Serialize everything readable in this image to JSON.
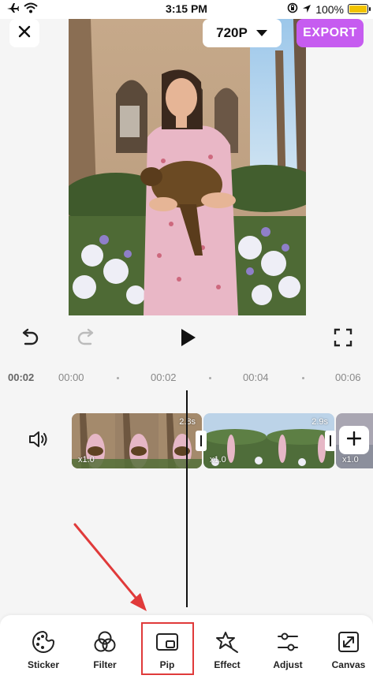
{
  "status_bar": {
    "time": "3:15 PM",
    "battery": "100%"
  },
  "header": {
    "resolution": "720P",
    "export_label": "EXPORT"
  },
  "timeline": {
    "current_time": "00:02",
    "ruler_ticks": [
      "00:00",
      "00:02",
      "00:04",
      "00:06"
    ],
    "clips": [
      {
        "duration": "2.8s",
        "speed": "x1.0"
      },
      {
        "duration": "2.9s",
        "speed": "x1.0"
      },
      {
        "speed": "x1.0"
      }
    ]
  },
  "toolbar": {
    "items": [
      "Sticker",
      "Filter",
      "Pip",
      "Effect",
      "Adjust",
      "Canvas"
    ]
  },
  "colors": {
    "accent": "#c65cf0",
    "highlight": "#e03a3a"
  }
}
